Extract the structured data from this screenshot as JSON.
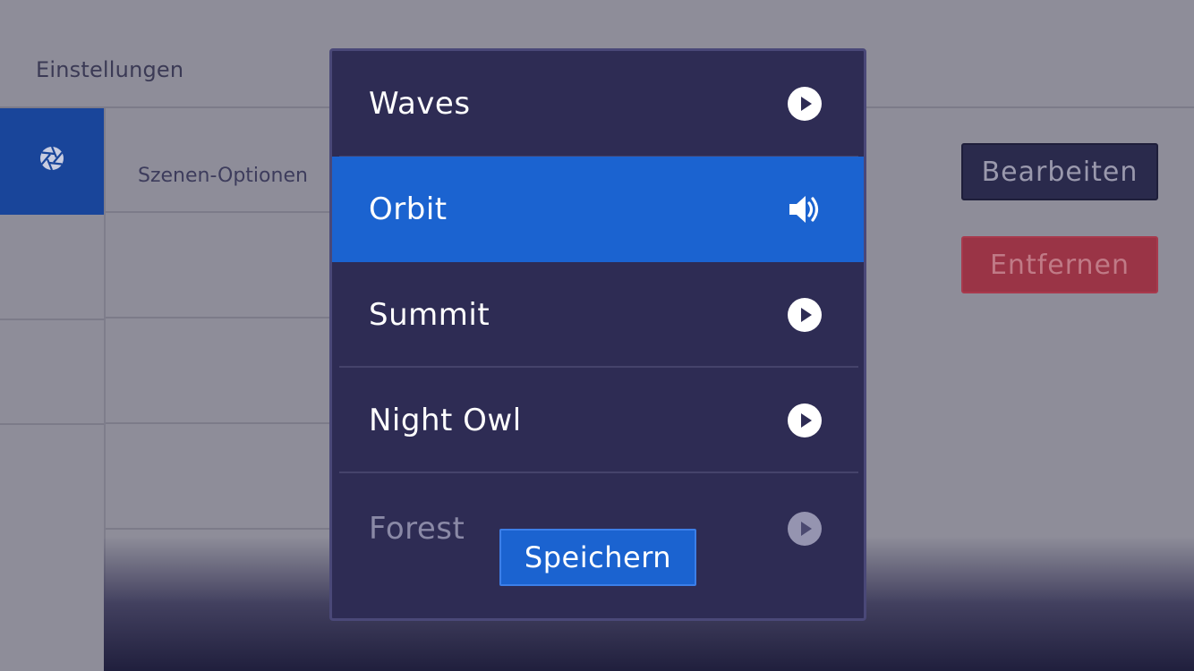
{
  "header": {
    "title": "Einstellungen"
  },
  "sidebar": {
    "active_icon": "aperture-icon"
  },
  "content": {
    "section_label": "Szenen-Optionen",
    "edit_label": "Bearbeiten",
    "remove_label": "Entfernen"
  },
  "modal": {
    "items": [
      {
        "label": "Waves",
        "icon": "play-icon",
        "state": "normal"
      },
      {
        "label": "Orbit",
        "icon": "speaker-icon",
        "state": "selected"
      },
      {
        "label": "Summit",
        "icon": "play-icon",
        "state": "normal"
      },
      {
        "label": "Night Owl",
        "icon": "play-icon",
        "state": "normal"
      },
      {
        "label": "Forest",
        "icon": "play-icon",
        "state": "faded"
      }
    ],
    "save_label": "Speichern"
  },
  "colors": {
    "accent": "#1b63d0",
    "modal_bg": "#2e2c54",
    "danger": "#9a3446",
    "sidebar_active": "#19459a"
  }
}
